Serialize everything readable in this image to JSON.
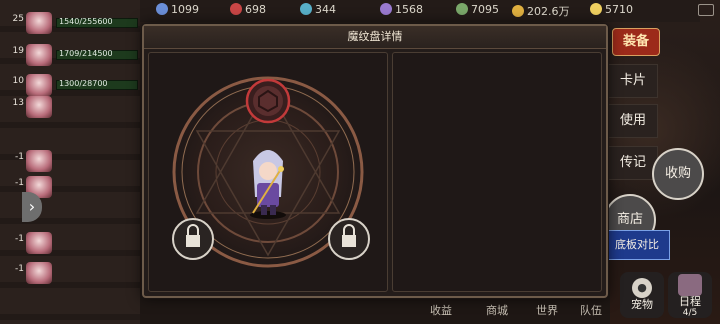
{
  "modal": {
    "title": "魔纹盘详情"
  },
  "top_resources": [
    "1099",
    "698",
    "344",
    "1568",
    "7095",
    "202.6万",
    "5710"
  ],
  "left_list": [
    {
      "level": "25",
      "hp": "1540/255600"
    },
    {
      "level": "19",
      "hp": "1709/214500"
    },
    {
      "level": "10",
      "hp": "1300/28700"
    },
    {
      "level": "13",
      "hp": ""
    },
    {
      "level": "-1",
      "hp": ""
    },
    {
      "level": "-1",
      "hp": ""
    },
    {
      "level": "-1",
      "hp": ""
    },
    {
      "level": "-1",
      "hp": ""
    }
  ],
  "side_menu": {
    "equip": "装备",
    "card": "卡片",
    "use": "使用",
    "legend": "传记",
    "collect": "收购",
    "shop": "商店",
    "compare": "底板对比",
    "pet": "宠物",
    "schedule": "日程",
    "schedule_count": "4/5"
  },
  "bottom_bar": [
    "收益",
    "商城",
    "世界",
    "队伍"
  ],
  "icons": {
    "top_slot": "magic-rune-socket-icon",
    "left_slot": "locked-slot-icon",
    "right_slot": "locked-slot-icon",
    "collapse": "chevron-right-icon"
  },
  "colors": {
    "accent": "#9c2a1a",
    "gold": "#d9a060",
    "compare_blue": "#1e3a8c"
  }
}
